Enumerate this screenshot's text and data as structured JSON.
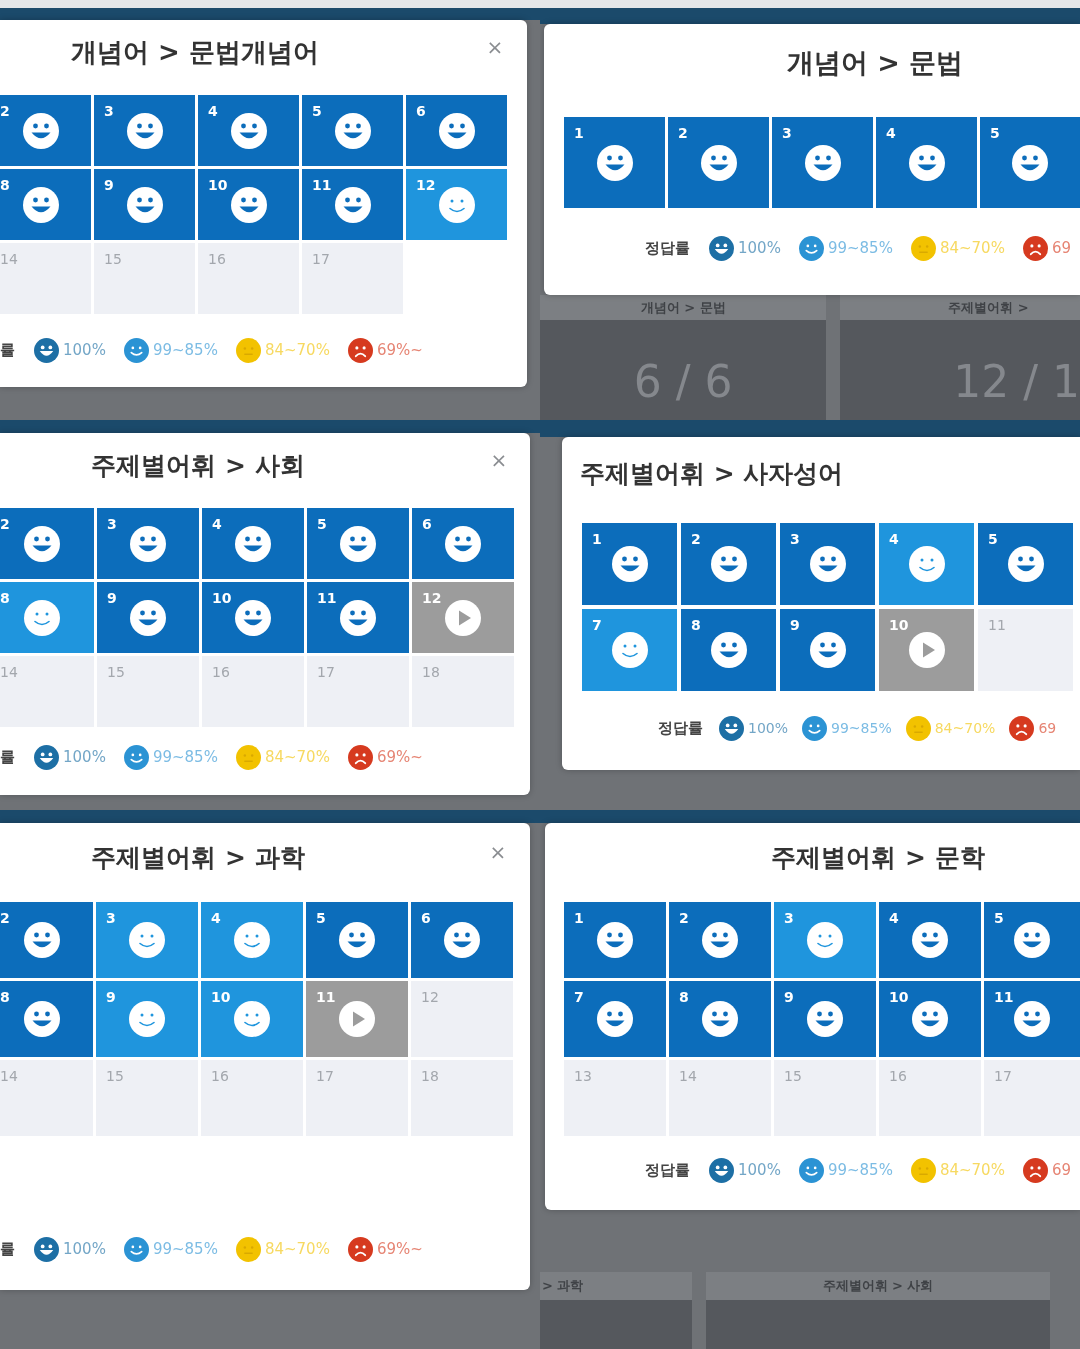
{
  "panels": [
    {
      "title": "개념어 > 문법개념어",
      "close": "×",
      "rows": [
        [
          {
            "number": "2",
            "kind": "perfect"
          },
          {
            "number": "3",
            "kind": "perfect"
          },
          {
            "number": "4",
            "kind": "perfect"
          },
          {
            "number": "5",
            "kind": "perfect"
          },
          {
            "number": "6",
            "kind": "perfect"
          }
        ],
        [
          {
            "number": "8",
            "kind": "perfect"
          },
          {
            "number": "9",
            "kind": "perfect"
          },
          {
            "number": "10",
            "kind": "perfect"
          },
          {
            "number": "11",
            "kind": "perfect"
          },
          {
            "number": "12",
            "kind": "good"
          }
        ],
        [
          {
            "number": "14",
            "kind": "empty"
          },
          {
            "number": "15",
            "kind": "empty"
          },
          {
            "number": "16",
            "kind": "empty"
          },
          {
            "number": "17",
            "kind": "empty"
          }
        ]
      ],
      "legend": {
        "label": "률",
        "items": [
          {
            "kind": "grin",
            "color": "#1d6fa5",
            "text": "100%"
          },
          {
            "kind": "smile",
            "color": "#2b93d4",
            "text": "99~85%"
          },
          {
            "kind": "neutral",
            "color": "#f2c200",
            "text": "84~70%"
          },
          {
            "kind": "frown",
            "color": "#d63a1f",
            "text": "69%~"
          }
        ]
      }
    },
    {
      "title": "개념어 > 문법",
      "rows": [
        [
          {
            "number": "1",
            "kind": "perfect"
          },
          {
            "number": "2",
            "kind": "perfect"
          },
          {
            "number": "3",
            "kind": "perfect"
          },
          {
            "number": "4",
            "kind": "perfect"
          },
          {
            "number": "5",
            "kind": "perfect"
          }
        ]
      ],
      "legend": {
        "label": "정답률",
        "items": [
          {
            "kind": "grin",
            "color": "#1d6fa5",
            "text": "100%"
          },
          {
            "kind": "smile",
            "color": "#2b93d4",
            "text": "99~85%"
          },
          {
            "kind": "neutral",
            "color": "#f2c200",
            "text": "84~70%"
          },
          {
            "kind": "frown",
            "color": "#d63a1f",
            "text": "69"
          }
        ]
      },
      "background_cards": [
        {
          "title": "개념어 > 문법",
          "count": "6 / 6"
        },
        {
          "title": "주제별어휘 >",
          "count": "12 / 1"
        }
      ]
    },
    {
      "title": "주제별어휘 > 사회",
      "close": "×",
      "rows": [
        [
          {
            "number": "2",
            "kind": "perfect"
          },
          {
            "number": "3",
            "kind": "perfect"
          },
          {
            "number": "4",
            "kind": "perfect"
          },
          {
            "number": "5",
            "kind": "perfect"
          },
          {
            "number": "6",
            "kind": "perfect"
          }
        ],
        [
          {
            "number": "8",
            "kind": "good"
          },
          {
            "number": "9",
            "kind": "perfect"
          },
          {
            "number": "10",
            "kind": "perfect"
          },
          {
            "number": "11",
            "kind": "perfect"
          },
          {
            "number": "12",
            "kind": "current"
          }
        ],
        [
          {
            "number": "14",
            "kind": "empty"
          },
          {
            "number": "15",
            "kind": "empty"
          },
          {
            "number": "16",
            "kind": "empty"
          },
          {
            "number": "17",
            "kind": "empty"
          },
          {
            "number": "18",
            "kind": "empty"
          }
        ]
      ],
      "legend": {
        "label": "률",
        "items": [
          {
            "kind": "grin",
            "color": "#1d6fa5",
            "text": "100%"
          },
          {
            "kind": "smile",
            "color": "#2b93d4",
            "text": "99~85%"
          },
          {
            "kind": "neutral",
            "color": "#f2c200",
            "text": "84~70%"
          },
          {
            "kind": "frown",
            "color": "#d63a1f",
            "text": "69%~"
          }
        ]
      }
    },
    {
      "title": "주제별어휘 > 사자성어",
      "rows": [
        [
          {
            "number": "1",
            "kind": "perfect"
          },
          {
            "number": "2",
            "kind": "perfect"
          },
          {
            "number": "3",
            "kind": "perfect"
          },
          {
            "number": "4",
            "kind": "good"
          },
          {
            "number": "5",
            "kind": "perfect"
          }
        ],
        [
          {
            "number": "7",
            "kind": "good"
          },
          {
            "number": "8",
            "kind": "perfect"
          },
          {
            "number": "9",
            "kind": "perfect"
          },
          {
            "number": "10",
            "kind": "current"
          },
          {
            "number": "11",
            "kind": "empty"
          }
        ]
      ],
      "legend": {
        "label": "정답률",
        "items": [
          {
            "kind": "grin",
            "color": "#1d6fa5",
            "text": "100%"
          },
          {
            "kind": "smile",
            "color": "#2b93d4",
            "text": "99~85%"
          },
          {
            "kind": "neutral",
            "color": "#f2c200",
            "text": "84~70%"
          },
          {
            "kind": "frown",
            "color": "#d63a1f",
            "text": "69"
          }
        ]
      }
    },
    {
      "title": "주제별어휘 > 과학",
      "close": "×",
      "rows": [
        [
          {
            "number": "2",
            "kind": "perfect"
          },
          {
            "number": "3",
            "kind": "good"
          },
          {
            "number": "4",
            "kind": "good"
          },
          {
            "number": "5",
            "kind": "perfect"
          },
          {
            "number": "6",
            "kind": "perfect"
          }
        ],
        [
          {
            "number": "8",
            "kind": "perfect"
          },
          {
            "number": "9",
            "kind": "good"
          },
          {
            "number": "10",
            "kind": "good"
          },
          {
            "number": "11",
            "kind": "current"
          },
          {
            "number": "12",
            "kind": "empty"
          }
        ],
        [
          {
            "number": "14",
            "kind": "empty"
          },
          {
            "number": "15",
            "kind": "empty"
          },
          {
            "number": "16",
            "kind": "empty"
          },
          {
            "number": "17",
            "kind": "empty"
          },
          {
            "number": "18",
            "kind": "empty"
          }
        ]
      ],
      "legend": {
        "label": "률",
        "items": [
          {
            "kind": "grin",
            "color": "#1d6fa5",
            "text": "100%"
          },
          {
            "kind": "smile",
            "color": "#2b93d4",
            "text": "99~85%"
          },
          {
            "kind": "neutral",
            "color": "#f2c200",
            "text": "84~70%"
          },
          {
            "kind": "frown",
            "color": "#d63a1f",
            "text": "69%~"
          }
        ]
      }
    },
    {
      "title": "주제별어휘 > 문학",
      "rows": [
        [
          {
            "number": "1",
            "kind": "perfect"
          },
          {
            "number": "2",
            "kind": "perfect"
          },
          {
            "number": "3",
            "kind": "good"
          },
          {
            "number": "4",
            "kind": "perfect"
          },
          {
            "number": "5",
            "kind": "perfect"
          }
        ],
        [
          {
            "number": "7",
            "kind": "perfect"
          },
          {
            "number": "8",
            "kind": "perfect"
          },
          {
            "number": "9",
            "kind": "perfect"
          },
          {
            "number": "10",
            "kind": "perfect"
          },
          {
            "number": "11",
            "kind": "perfect"
          }
        ],
        [
          {
            "number": "13",
            "kind": "empty"
          },
          {
            "number": "14",
            "kind": "empty"
          },
          {
            "number": "15",
            "kind": "empty"
          },
          {
            "number": "16",
            "kind": "empty"
          },
          {
            "number": "17",
            "kind": "empty"
          }
        ]
      ],
      "legend": {
        "label": "정답률",
        "items": [
          {
            "kind": "grin",
            "color": "#1d6fa5",
            "text": "100%"
          },
          {
            "kind": "smile",
            "color": "#2b93d4",
            "text": "99~85%"
          },
          {
            "kind": "neutral",
            "color": "#f2c200",
            "text": "84~70%"
          },
          {
            "kind": "frown",
            "color": "#d63a1f",
            "text": "69"
          }
        ]
      },
      "background_cards": [
        {
          "title": "> 과학"
        },
        {
          "title": "주제별어휘 > 사회"
        }
      ]
    }
  ]
}
